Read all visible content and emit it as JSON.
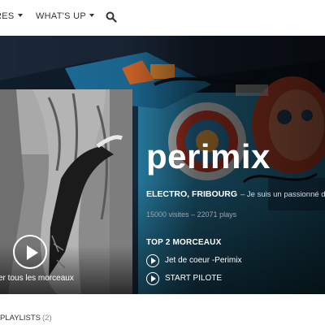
{
  "nav": {
    "genres_label": "RES",
    "whatsup_label": "WHAT'S UP",
    "icons": {
      "search": "search-icon",
      "caret": "caret-down-icon"
    }
  },
  "artist": {
    "name": "perimix",
    "genre": "ELECTRO, FRIBOURG",
    "description": "– Je suis un passionné de m",
    "stats": "15000 visites – 22071 plays"
  },
  "player": {
    "play_all_label": "er tous les morceaux",
    "top_title": "TOP 2 MORCEAUX",
    "tracks": [
      {
        "title": "Jet de coeur -Perimix"
      },
      {
        "title": "START PILOTE"
      }
    ],
    "icons": {
      "play": "play-icon"
    }
  },
  "sections": {
    "playlists_label": "PLAYLISTS",
    "playlists_count": "(2)"
  },
  "colors": {
    "accent_dark": "#12202e",
    "text": "#333333",
    "stats": "#9aa6b0"
  }
}
